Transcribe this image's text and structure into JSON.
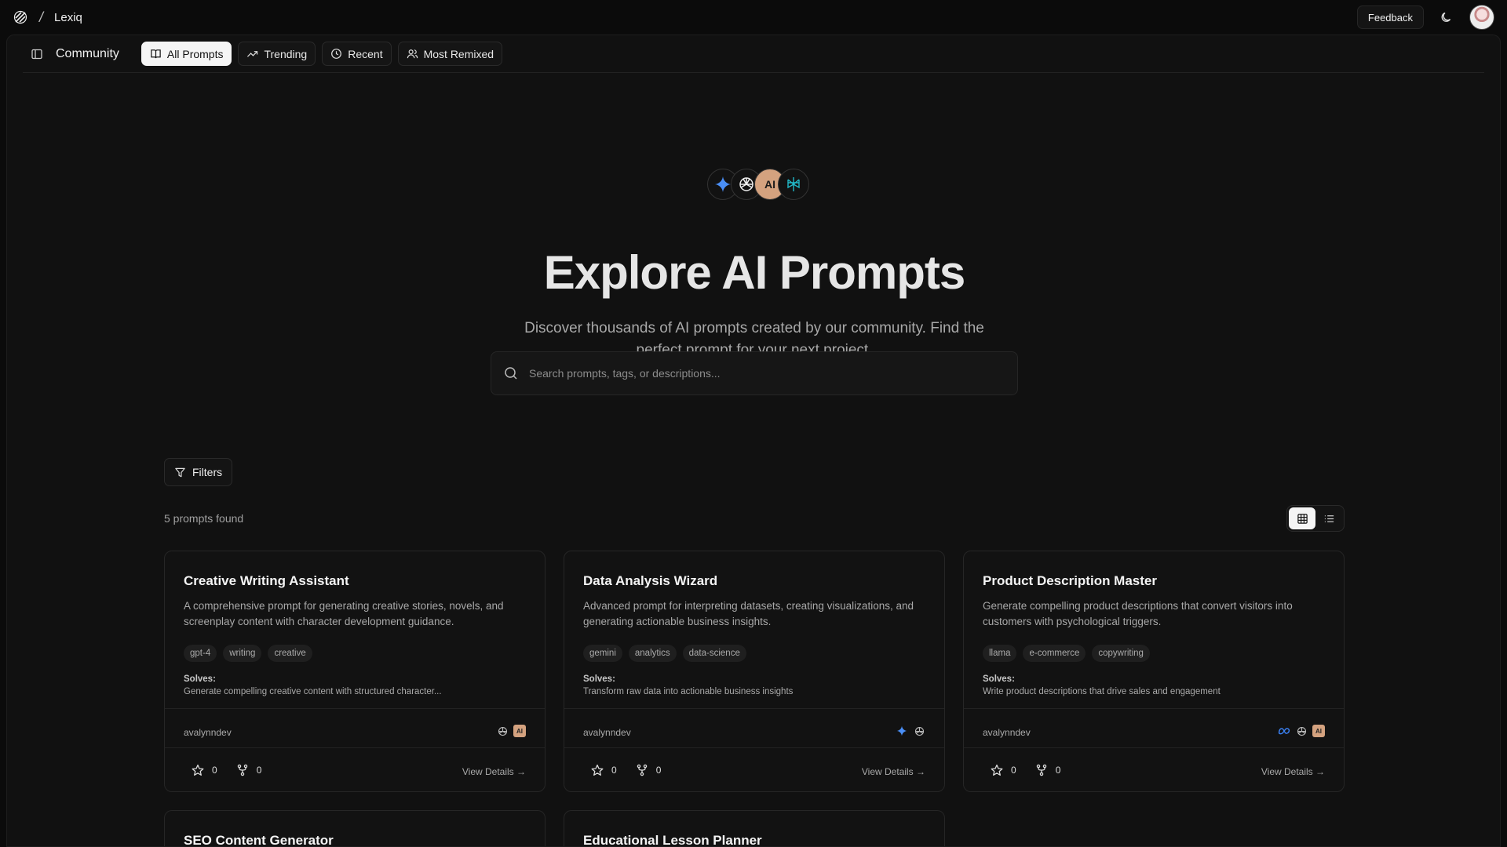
{
  "app": {
    "name": "Lexiq",
    "separator": "/"
  },
  "topbar": {
    "feedback_label": "Feedback"
  },
  "subnav": {
    "title": "Community",
    "tabs": [
      {
        "label": "All Prompts",
        "icon": "book-icon"
      },
      {
        "label": "Trending",
        "icon": "trending-icon"
      },
      {
        "label": "Recent",
        "icon": "clock-icon"
      },
      {
        "label": "Most Remixed",
        "icon": "users-icon"
      }
    ]
  },
  "hero": {
    "model_icons": [
      "gemini-icon",
      "openai-icon",
      "anthropic-icon",
      "perplexity-icon"
    ],
    "anthropic_text": "AI",
    "title": "Explore AI Prompts",
    "subtitle": "Discover thousands of AI prompts created by our community. Find the perfect prompt for your next project."
  },
  "search": {
    "placeholder": "Search prompts, tags, or descriptions...",
    "value": ""
  },
  "filters": {
    "label": "Filters"
  },
  "results": {
    "count_text": "5 prompts found",
    "view_mode": "grid"
  },
  "cards": [
    {
      "title": "Creative Writing Assistant",
      "description": "A comprehensive prompt for generating creative stories, novels, and screenplay content with character development guidance.",
      "tags": [
        "gpt-4",
        "writing",
        "creative"
      ],
      "solves_label": "Solves:",
      "solves": "Generate compelling creative content with structured character...",
      "author": "avalynndev",
      "models": [
        "openai-icon",
        "anthropic-icon"
      ],
      "stars": "0",
      "remixes": "0",
      "details_label": "View Details →"
    },
    {
      "title": "Data Analysis Wizard",
      "description": "Advanced prompt for interpreting datasets, creating visualizations, and generating actionable business insights.",
      "tags": [
        "gemini",
        "analytics",
        "data-science"
      ],
      "solves_label": "Solves:",
      "solves": "Transform raw data into actionable business insights",
      "author": "avalynndev",
      "models": [
        "gemini-icon",
        "openai-icon"
      ],
      "stars": "0",
      "remixes": "0",
      "details_label": "View Details →"
    },
    {
      "title": "Product Description Master",
      "description": "Generate compelling product descriptions that convert visitors into customers with psychological triggers.",
      "tags": [
        "llama",
        "e-commerce",
        "copywriting"
      ],
      "solves_label": "Solves:",
      "solves": "Write product descriptions that drive sales and engagement",
      "author": "avalynndev",
      "models": [
        "meta-icon",
        "openai-icon",
        "anthropic-icon"
      ],
      "stars": "0",
      "remixes": "0",
      "details_label": "View Details →"
    },
    {
      "title": "SEO Content Generator"
    },
    {
      "title": "Educational Lesson Planner"
    }
  ],
  "colors": {
    "background": "#0b0b0b",
    "panel": "#111111",
    "gemini": "#4a8ff7",
    "anthropic": "#d4a27f",
    "meta": "#3b82f6"
  }
}
